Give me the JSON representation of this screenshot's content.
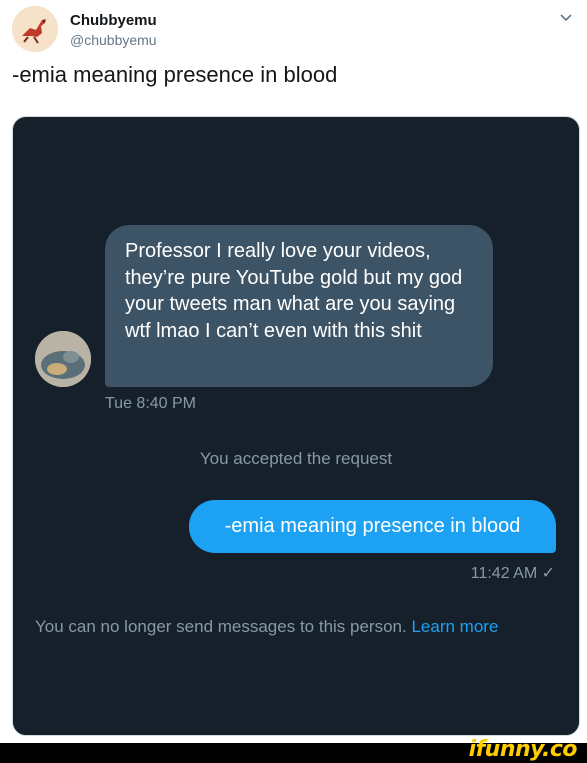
{
  "tweet": {
    "author_name": "Chubbyemu",
    "author_handle": "@chubbyemu",
    "text": "-emia meaning presence in blood",
    "avatar_icon": "bird-logo-icon",
    "menu_icon": "chevron-down-icon"
  },
  "conversation": {
    "incoming_message": "Professor I really love your videos, they’re pure YouTube gold but my god your tweets man what are you saying wtf lmao I can’t even with this shit",
    "incoming_time": "Tue 8:40 PM",
    "system_message": "You accepted the request",
    "outgoing_message": "-emia meaning presence in blood",
    "outgoing_time": "11:42 AM ✓",
    "notice_text": "You can no longer send messages to this person.",
    "learn_more": "Learn more"
  },
  "footer": {
    "brand": "ifunny.co"
  },
  "colors": {
    "dark_bg": "#15202b",
    "incoming_bubble": "#3d5466",
    "outgoing_bubble": "#1da1f2",
    "muted_text": "#8899a6",
    "link": "#1da1f2",
    "brand": "#ffcc00"
  }
}
